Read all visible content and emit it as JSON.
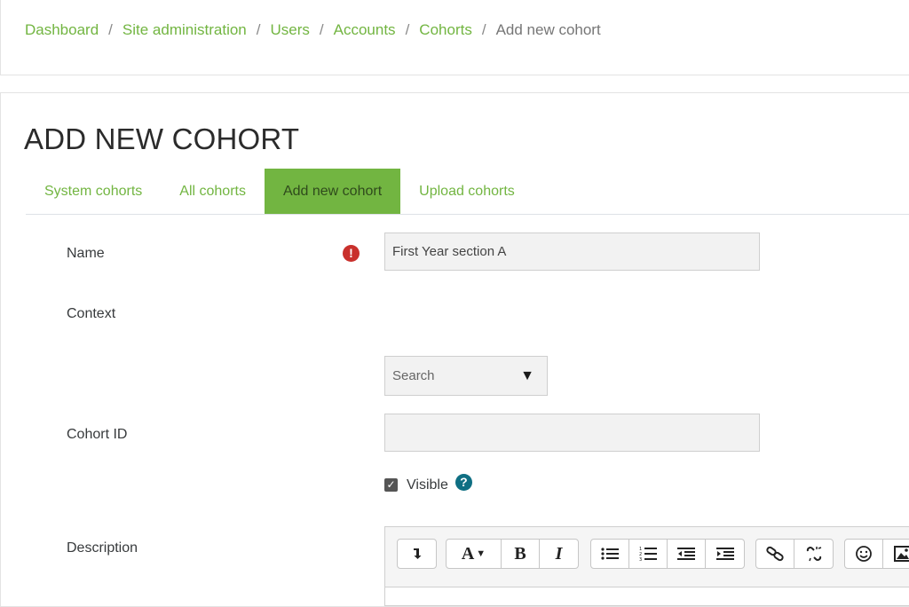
{
  "breadcrumb": {
    "items": [
      "Dashboard",
      "Site administration",
      "Users",
      "Accounts",
      "Cohorts"
    ],
    "current": "Add new cohort",
    "separator": "/"
  },
  "page": {
    "title": "ADD NEW COHORT"
  },
  "tabs": [
    {
      "label": "System cohorts"
    },
    {
      "label": "All cohorts"
    },
    {
      "label": "Add new cohort",
      "active": true
    },
    {
      "label": "Upload cohorts"
    }
  ],
  "form": {
    "name": {
      "label": "Name",
      "value": "First Year section A",
      "required_icon": "exclamation-circle-icon"
    },
    "context": {
      "label": "Context",
      "placeholder": "Search",
      "caret": "▼"
    },
    "cohort_id": {
      "label": "Cohort ID",
      "value": ""
    },
    "visible": {
      "label": "Visible",
      "checked": true,
      "help_icon": "question-circle-icon"
    },
    "description": {
      "label": "Description"
    }
  },
  "editor_toolbar": {
    "icons": [
      "collapse-icon",
      "paragraph-style-icon",
      "bold-icon",
      "italic-icon",
      "unordered-list-icon",
      "ordered-list-icon",
      "outdent-icon",
      "indent-icon",
      "link-icon",
      "unlink-icon",
      "emoji-icon",
      "image-icon"
    ]
  },
  "colors": {
    "brand_green": "#72b541",
    "error_red": "#c9302c",
    "help_teal": "#0f6f83"
  }
}
